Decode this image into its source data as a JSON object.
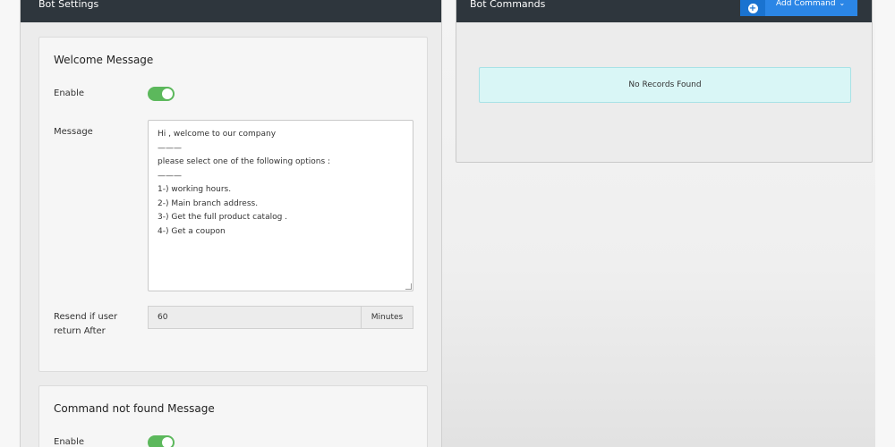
{
  "bot_settings": {
    "title": "Bot Settings",
    "welcome_card": {
      "title": "Welcome Message",
      "enable_label": "Enable",
      "enabled": true,
      "message_label": "Message",
      "message_value": "Hi , welcome to our company\n———\nplease select one of the following options :\n———\n1-) working hours.\n2-) Main branch address.\n3-) Get the full product catalog .\n4-) Get a coupon",
      "resend_label": "Resend if user return After",
      "resend_value": "60",
      "resend_unit": "Minutes"
    },
    "not_found_card": {
      "title": "Command not found Message",
      "enable_label": "Enable",
      "enabled": true
    }
  },
  "bot_commands": {
    "title": "Bot Commands",
    "add_button_label": "Add Command",
    "empty_text": "No Records Found"
  },
  "icons": {
    "plus": "plus-circle-icon",
    "chevron": "chevron-down-icon",
    "toggle": "toggle-switch"
  },
  "colors": {
    "header_bg": "#2e363d",
    "toggle_on": "#5cb85c",
    "primary": "#2b86e6",
    "info_bg": "#d9f6f6"
  }
}
